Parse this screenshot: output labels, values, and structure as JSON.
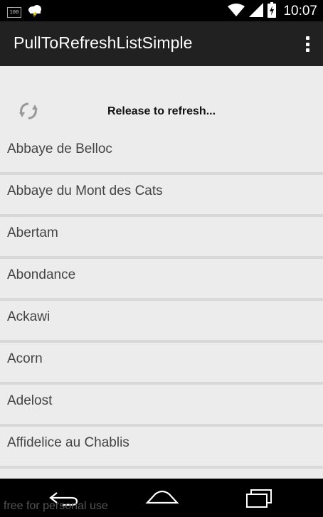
{
  "status_bar": {
    "notification_count": "100",
    "clock": "10:07"
  },
  "action_bar": {
    "title": "PullToRefreshListSimple"
  },
  "refresh_header": {
    "text": "Release to refresh..."
  },
  "list": {
    "items": [
      "Abbaye de Belloc",
      "Abbaye du Mont des Cats",
      "Abertam",
      "Abondance",
      "Ackawi",
      "Acorn",
      "Adelost",
      "Affidelice au Chablis"
    ]
  },
  "watermark": {
    "text": "free for personal use"
  },
  "colors": {
    "action_bar_bg": "#212121",
    "content_bg": "#ececec",
    "divider": "#d8d8d8",
    "battery_charge": "#ffffff",
    "lightning": "#ffd600"
  },
  "icons": {
    "status_left": [
      "notification-box-icon",
      "weather-storm-icon"
    ],
    "status_right": [
      "wifi-icon",
      "cell-signal-icon",
      "battery-charging-icon"
    ],
    "refresh": "refresh-icon",
    "overflow": "overflow-menu-icon",
    "nav": [
      "back-icon",
      "home-icon",
      "recent-apps-icon"
    ]
  }
}
